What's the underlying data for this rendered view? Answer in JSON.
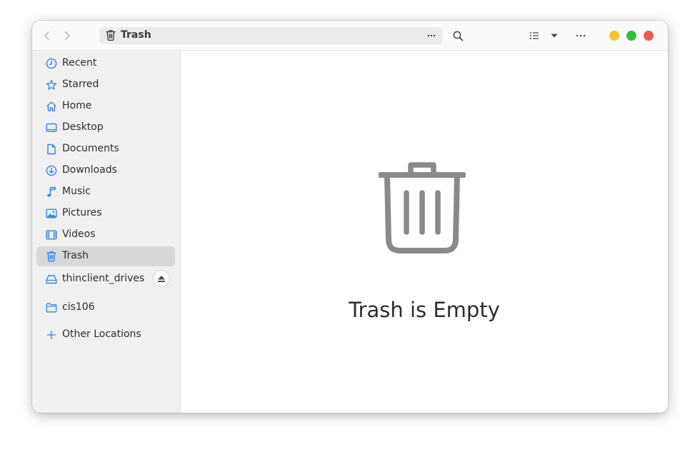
{
  "window": {
    "title": "Trash"
  },
  "toolbar": {
    "path": {
      "label": "Trash",
      "icon": "trash-icon"
    },
    "buttons": [
      "back",
      "forward",
      "path-menu",
      "search",
      "list-view",
      "view-options",
      "main-menu"
    ]
  },
  "window_controls": {
    "minimize_color": "#f6c42d",
    "maximize_color": "#2ec23f",
    "close_color": "#ed5a53"
  },
  "sidebar": {
    "items": [
      {
        "label": "Recent",
        "icon": "clock-icon"
      },
      {
        "label": "Starred",
        "icon": "star-icon"
      },
      {
        "label": "Home",
        "icon": "home-icon"
      },
      {
        "label": "Desktop",
        "icon": "desktop-icon"
      },
      {
        "label": "Documents",
        "icon": "document-icon"
      },
      {
        "label": "Downloads",
        "icon": "download-icon"
      },
      {
        "label": "Music",
        "icon": "music-icon"
      },
      {
        "label": "Pictures",
        "icon": "picture-icon"
      },
      {
        "label": "Videos",
        "icon": "video-icon"
      },
      {
        "label": "Trash",
        "icon": "trash-icon",
        "active": true
      }
    ],
    "drives": [
      {
        "label": "thinclient_drives",
        "icon": "drive-icon"
      }
    ],
    "bookmarks": [
      {
        "label": "cis106",
        "icon": "folder-icon"
      }
    ],
    "other_locations": {
      "label": "Other Locations",
      "icon": "plus-icon"
    }
  },
  "main": {
    "empty_state": {
      "message": "Trash is Empty",
      "icon": "trash-large-icon"
    }
  },
  "colors": {
    "accent": "#3584e4",
    "icon_gray": "#8a8a8a"
  }
}
